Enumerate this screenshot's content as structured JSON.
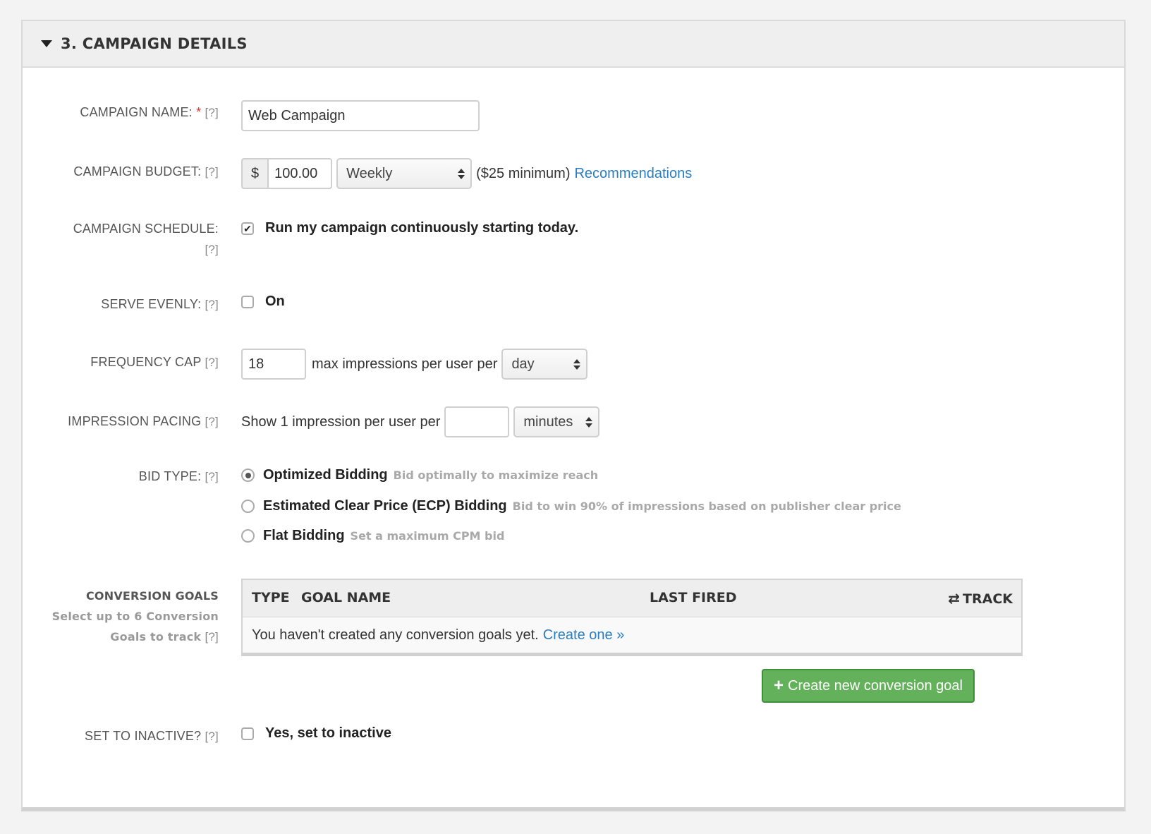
{
  "header": {
    "title": "3.  CAMPAIGN DETAILS"
  },
  "help_text": "[?]",
  "campaign_name": {
    "label": "CAMPAIGN NAME:",
    "required_mark": "*",
    "value": "Web Campaign"
  },
  "campaign_budget": {
    "label": "CAMPAIGN BUDGET:",
    "currency": "$",
    "amount": "100.00",
    "period": "Weekly",
    "minimum_note": "($25 minimum)",
    "recommendations_link": "Recommendations"
  },
  "campaign_schedule": {
    "label": "CAMPAIGN SCHEDULE:",
    "checked": true,
    "option_label": "Run my campaign continuously starting today."
  },
  "serve_evenly": {
    "label": "SERVE EVENLY:",
    "checked": false,
    "option_label": "On"
  },
  "frequency_cap": {
    "label": "FREQUENCY CAP",
    "value": "18",
    "text": "max impressions per user per",
    "period": "day"
  },
  "impression_pacing": {
    "label": "IMPRESSION PACING",
    "text": "Show 1 impression per user per",
    "value": "",
    "unit": "minutes"
  },
  "bid_type": {
    "label": "BID TYPE:",
    "options": [
      {
        "label": "Optimized Bidding",
        "hint": "Bid optimally to maximize reach",
        "selected": true
      },
      {
        "label": "Estimated Clear Price (ECP) Bidding",
        "hint": "Bid to win 90% of impressions based on publisher clear price",
        "selected": false
      },
      {
        "label": "Flat Bidding",
        "hint": "Set a maximum CPM bid",
        "selected": false
      }
    ]
  },
  "conversion_goals": {
    "label": "CONVERSION GOALS",
    "sub_label_line1": "Select up to 6 Conversion",
    "sub_label_line2": "Goals to track",
    "columns": {
      "type": "TYPE",
      "goal_name": "GOAL NAME",
      "last_fired": "LAST FIRED",
      "track": "TRACK"
    },
    "empty_message": "You haven't created any conversion goals yet.",
    "create_link": "Create one »",
    "create_button": "Create new conversion goal"
  },
  "set_inactive": {
    "label": "SET TO INACTIVE?",
    "checked": false,
    "option_label": "Yes, set to inactive"
  }
}
